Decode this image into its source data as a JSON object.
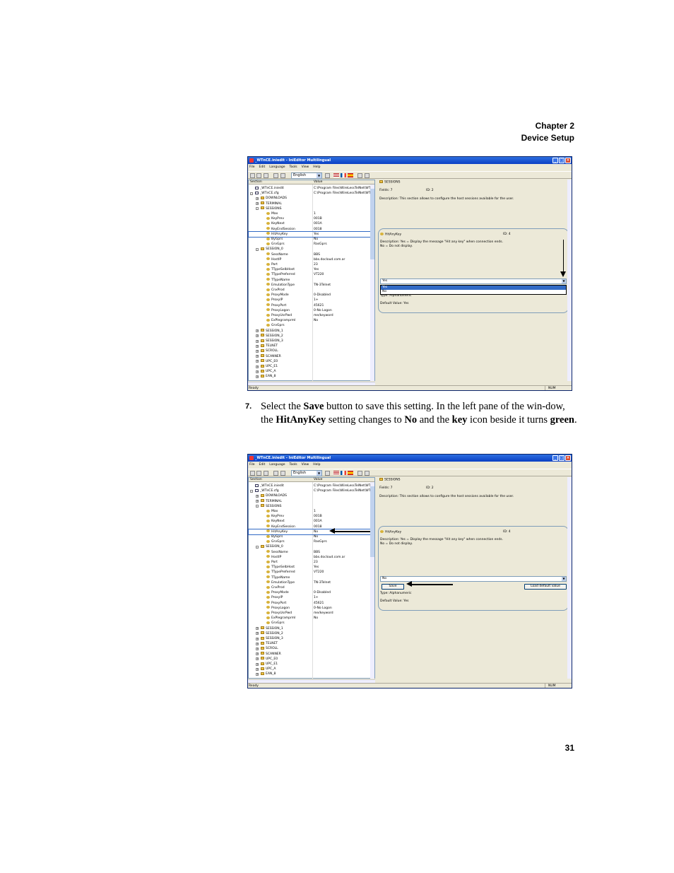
{
  "page": {
    "chapter": "Chapter 2",
    "section": "Device Setup",
    "page_number": "31"
  },
  "step": {
    "number": "7.",
    "parts": [
      {
        "t": "Select the ",
        "b": false
      },
      {
        "t": "Save",
        "b": true
      },
      {
        "t": " button to save this setting. In the left pane of the win-dow, the ",
        "b": false
      },
      {
        "t": "HitAnyKey",
        "b": true
      },
      {
        "t": " setting changes to ",
        "b": false
      },
      {
        "t": "No",
        "b": true
      },
      {
        "t": " and the ",
        "b": false
      },
      {
        "t": "key",
        "b": true
      },
      {
        "t": " icon beside it turns ",
        "b": false
      },
      {
        "t": "green",
        "b": true
      },
      {
        "t": ".",
        "b": false
      }
    ]
  },
  "app": {
    "title": "_WTnCE.iniedit - IniEditor Multilingual",
    "menu": [
      "File",
      "Edit",
      "Language",
      "Tools",
      "View",
      "Help"
    ],
    "language": "English",
    "tree_header": {
      "section": "Section",
      "value": "Value"
    },
    "status": "Ready",
    "status_num": "NUM",
    "section_panel": {
      "name": "SESSIONS",
      "fields": "Fields: 7",
      "id": "ID: 2",
      "description": "Description: This section allows to configure the host sessions available for the user."
    },
    "key_panel": {
      "name": "HitAnyKey",
      "id": "ID: 4",
      "description1": "Description: Yes = Display the message \"Hit any key\" when connection ends.",
      "description2": "No = Do not display.",
      "type": "Type: Alphanumeric",
      "default": "Default Value: Yes",
      "save_label": "Save",
      "load_default_label": "Load default value"
    }
  },
  "screenshot1": {
    "dropdown_value": "Yes",
    "dropdown_options": [
      "Yes",
      "No"
    ],
    "dropdown_highlight": "Yes",
    "rows": [
      {
        "d": 0,
        "exp": "",
        "i": "doc",
        "n": "_WTnCE.iniedit",
        "v": "C:\\Program Files\\WireLessTelNet\\WTn"
      },
      {
        "d": 0,
        "exp": "-",
        "i": "doc",
        "n": "_WTnCE.cfg",
        "v": "C:\\Program Files\\WireLessTelNet\\WTn"
      },
      {
        "d": 1,
        "exp": "+",
        "i": "folder",
        "n": "DOWNLOADS",
        "v": ""
      },
      {
        "d": 1,
        "exp": "+",
        "i": "folder",
        "n": "TERMINAL",
        "v": ""
      },
      {
        "d": 1,
        "exp": "-",
        "i": "folder",
        "n": "SESSIONS",
        "v": ""
      },
      {
        "d": 2,
        "exp": "",
        "i": "key",
        "n": "Max",
        "v": "1"
      },
      {
        "d": 2,
        "exp": "",
        "i": "key",
        "n": "KeyPrev",
        "v": "001B"
      },
      {
        "d": 2,
        "exp": "",
        "i": "key",
        "n": "KeyNext",
        "v": "001A"
      },
      {
        "d": 2,
        "exp": "",
        "i": "key",
        "n": "KeyEndSession",
        "v": "0018"
      },
      {
        "d": 2,
        "exp": "",
        "i": "key",
        "n": "HitAnyKey",
        "v": "Yes",
        "sel": true
      },
      {
        "d": 2,
        "exp": "",
        "i": "key",
        "n": "ByGprs",
        "v": "No"
      },
      {
        "d": 2,
        "exp": "",
        "i": "key",
        "n": "GrvGprs",
        "v": "RasGprs"
      },
      {
        "d": 1,
        "exp": "-",
        "i": "folder",
        "n": "SESSION_0",
        "v": ""
      },
      {
        "d": 2,
        "exp": "",
        "i": "key",
        "n": "SessName",
        "v": "BBS"
      },
      {
        "d": 2,
        "exp": "",
        "i": "key",
        "n": "HostIP",
        "v": "bbs.docloud.com.ar"
      },
      {
        "d": 2,
        "exp": "",
        "i": "key",
        "n": "Port",
        "v": "23"
      },
      {
        "d": 2,
        "exp": "",
        "i": "key",
        "n": "TTypeSelbHost",
        "v": "Yes"
      },
      {
        "d": 2,
        "exp": "",
        "i": "key",
        "n": "TTypePreferred",
        "v": "VT220"
      },
      {
        "d": 2,
        "exp": "",
        "i": "key",
        "n": "TTypeName",
        "v": ""
      },
      {
        "d": 2,
        "exp": "",
        "i": "key",
        "n": "EmulationType",
        "v": "TN-3Telnet"
      },
      {
        "d": 2,
        "exp": "",
        "i": "key",
        "n": "CnxProd",
        "v": ""
      },
      {
        "d": 2,
        "exp": "",
        "i": "key",
        "n": "ProxyMode",
        "v": "0-Disabled"
      },
      {
        "d": 2,
        "exp": "",
        "i": "key",
        "n": "ProxyIP",
        "v": "1+"
      },
      {
        "d": 2,
        "exp": "",
        "i": "key",
        "n": "ProxyPort",
        "v": "45621"
      },
      {
        "d": 2,
        "exp": "",
        "i": "key",
        "n": "ProxyLogon",
        "v": "0-No Logon"
      },
      {
        "d": 2,
        "exp": "",
        "i": "key",
        "n": "ProxyUsrPwd",
        "v": "me/keyword"
      },
      {
        "d": 2,
        "exp": "",
        "i": "key",
        "n": "ExPlegramprml",
        "v": "No"
      },
      {
        "d": 2,
        "exp": "",
        "i": "key",
        "n": "GrvGprs",
        "v": ""
      },
      {
        "d": 1,
        "exp": "+",
        "i": "folder",
        "n": "SESSION_1",
        "v": ""
      },
      {
        "d": 1,
        "exp": "+",
        "i": "folder",
        "n": "SESSION_2",
        "v": ""
      },
      {
        "d": 1,
        "exp": "+",
        "i": "folder",
        "n": "SESSION_3",
        "v": ""
      },
      {
        "d": 1,
        "exp": "+",
        "i": "folder",
        "n": "TELNET",
        "v": ""
      },
      {
        "d": 1,
        "exp": "+",
        "i": "folder",
        "n": "SCROLL",
        "v": ""
      },
      {
        "d": 1,
        "exp": "+",
        "i": "folder",
        "n": "SCANNER",
        "v": ""
      },
      {
        "d": 1,
        "exp": "+",
        "i": "folder",
        "n": "UPC_E0",
        "v": ""
      },
      {
        "d": 1,
        "exp": "+",
        "i": "folder",
        "n": "UPC_E1",
        "v": ""
      },
      {
        "d": 1,
        "exp": "+",
        "i": "folder",
        "n": "UPC_A",
        "v": ""
      },
      {
        "d": 1,
        "exp": "+",
        "i": "folder",
        "n": "EAN_8",
        "v": ""
      }
    ]
  },
  "screenshot2": {
    "dropdown_value": "No",
    "rows": [
      {
        "d": 0,
        "exp": "",
        "i": "doc",
        "n": "_WTnCE.iniedit",
        "v": "C:\\Program Files\\WireLessTelNet\\WTn"
      },
      {
        "d": 0,
        "exp": "-",
        "i": "doc",
        "n": "_WTnCE.cfg",
        "v": "C:\\Program Files\\WireLessTelNet\\WTn"
      },
      {
        "d": 1,
        "exp": "+",
        "i": "folder",
        "n": "DOWNLOADS",
        "v": ""
      },
      {
        "d": 1,
        "exp": "+",
        "i": "folder",
        "n": "TERMINAL",
        "v": ""
      },
      {
        "d": 1,
        "exp": "-",
        "i": "folder",
        "n": "SESSIONS",
        "v": ""
      },
      {
        "d": 2,
        "exp": "",
        "i": "key",
        "n": "Max",
        "v": "1"
      },
      {
        "d": 2,
        "exp": "",
        "i": "key",
        "n": "KeyPrev",
        "v": "001B"
      },
      {
        "d": 2,
        "exp": "",
        "i": "key",
        "n": "KeyNext",
        "v": "001A"
      },
      {
        "d": 2,
        "exp": "",
        "i": "key",
        "n": "KeyEndSession",
        "v": "0018"
      },
      {
        "d": 2,
        "exp": "",
        "i": "key",
        "n": "HitAnyKey",
        "v": "No",
        "sel": true
      },
      {
        "d": 2,
        "exp": "",
        "i": "key",
        "n": "ByGprs",
        "v": "No"
      },
      {
        "d": 2,
        "exp": "",
        "i": "key",
        "n": "GrvGprs",
        "v": "RasGprs"
      },
      {
        "d": 1,
        "exp": "-",
        "i": "folder",
        "n": "SESSION_0",
        "v": ""
      },
      {
        "d": 2,
        "exp": "",
        "i": "key",
        "n": "SessName",
        "v": "BBS"
      },
      {
        "d": 2,
        "exp": "",
        "i": "key",
        "n": "HostIP",
        "v": "bbs.docloud.com.ar"
      },
      {
        "d": 2,
        "exp": "",
        "i": "key",
        "n": "Port",
        "v": "23"
      },
      {
        "d": 2,
        "exp": "",
        "i": "key",
        "n": "TTypeSelbHost",
        "v": "Yes"
      },
      {
        "d": 2,
        "exp": "",
        "i": "key",
        "n": "TTypePreferred",
        "v": "VT220"
      },
      {
        "d": 2,
        "exp": "",
        "i": "key",
        "n": "TTypeName",
        "v": ""
      },
      {
        "d": 2,
        "exp": "",
        "i": "key",
        "n": "EmulationType",
        "v": "TN-3Telnet"
      },
      {
        "d": 2,
        "exp": "",
        "i": "key",
        "n": "CnxProd",
        "v": ""
      },
      {
        "d": 2,
        "exp": "",
        "i": "key",
        "n": "ProxyMode",
        "v": "0-Disabled"
      },
      {
        "d": 2,
        "exp": "",
        "i": "key",
        "n": "ProxyIP",
        "v": "1+"
      },
      {
        "d": 2,
        "exp": "",
        "i": "key",
        "n": "ProxyPort",
        "v": "45621"
      },
      {
        "d": 2,
        "exp": "",
        "i": "key",
        "n": "ProxyLogon",
        "v": "0-No Logon"
      },
      {
        "d": 2,
        "exp": "",
        "i": "key",
        "n": "ProxyUsrPwd",
        "v": "me/keyword"
      },
      {
        "d": 2,
        "exp": "",
        "i": "key",
        "n": "ExPlegramprml",
        "v": "No"
      },
      {
        "d": 2,
        "exp": "",
        "i": "key",
        "n": "GrvGprs",
        "v": ""
      },
      {
        "d": 1,
        "exp": "+",
        "i": "folder",
        "n": "SESSION_1",
        "v": ""
      },
      {
        "d": 1,
        "exp": "+",
        "i": "folder",
        "n": "SESSION_2",
        "v": ""
      },
      {
        "d": 1,
        "exp": "+",
        "i": "folder",
        "n": "SESSION_3",
        "v": ""
      },
      {
        "d": 1,
        "exp": "+",
        "i": "folder",
        "n": "TELNET",
        "v": ""
      },
      {
        "d": 1,
        "exp": "+",
        "i": "folder",
        "n": "SCROLL",
        "v": ""
      },
      {
        "d": 1,
        "exp": "+",
        "i": "folder",
        "n": "SCANNER",
        "v": ""
      },
      {
        "d": 1,
        "exp": "+",
        "i": "folder",
        "n": "UPC_E0",
        "v": ""
      },
      {
        "d": 1,
        "exp": "+",
        "i": "folder",
        "n": "UPC_E1",
        "v": ""
      },
      {
        "d": 1,
        "exp": "+",
        "i": "folder",
        "n": "UPC_A",
        "v": ""
      },
      {
        "d": 1,
        "exp": "+",
        "i": "folder",
        "n": "EAN_8",
        "v": ""
      }
    ]
  }
}
